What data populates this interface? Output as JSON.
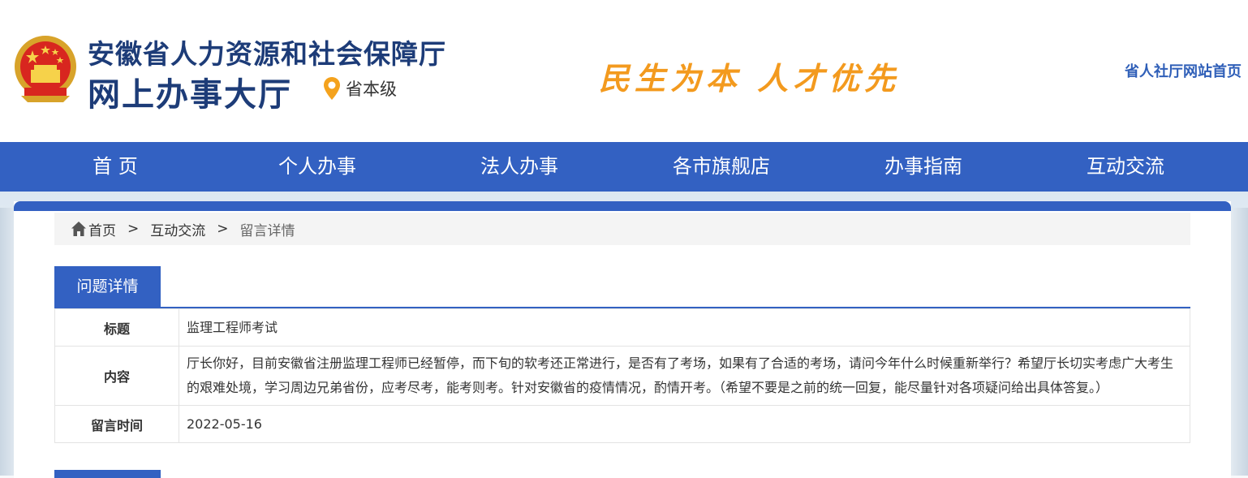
{
  "header": {
    "org_name": "安徽省人力资源和社会保障厅",
    "hall_name": "网上办事大厅",
    "level": "省本级",
    "slogan": "民生为本 人才优先",
    "site_link": "省人社厅网站首页",
    "brand_color": "#1d3c78",
    "slogan_color": "#f39a1e"
  },
  "nav": {
    "color": "#3361c2",
    "items": [
      {
        "label": "首 页"
      },
      {
        "label": "个人办事"
      },
      {
        "label": "法人办事"
      },
      {
        "label": "各市旗舰店"
      },
      {
        "label": "办事指南"
      },
      {
        "label": "互动交流"
      }
    ]
  },
  "breadcrumb": {
    "home": "首页",
    "sep": ">",
    "section": "互动交流",
    "current": "留言详情"
  },
  "tab": {
    "label": "问题详情"
  },
  "detail": {
    "title_label": "标题",
    "title_value": "监理工程师考试",
    "content_label": "内容",
    "content_value": "厅长你好，目前安徽省注册监理工程师已经暂停，而下旬的软考还正常进行，是否有了考场，如果有了合适的考场，请问今年什么时候重新举行？希望厅长切实考虑广大考生的艰难处境，学习周边兄弟省份，应考尽考，能考则考。针对安徽省的疫情情况，酌情开考。（希望不要是之前的统一回复，能尽量针对各项疑问给出具体答复。）",
    "time_label": "留言时间",
    "time_value": "2022-05-16"
  },
  "icons": [
    "national-emblem-icon",
    "location-pin-icon",
    "home-icon"
  ]
}
